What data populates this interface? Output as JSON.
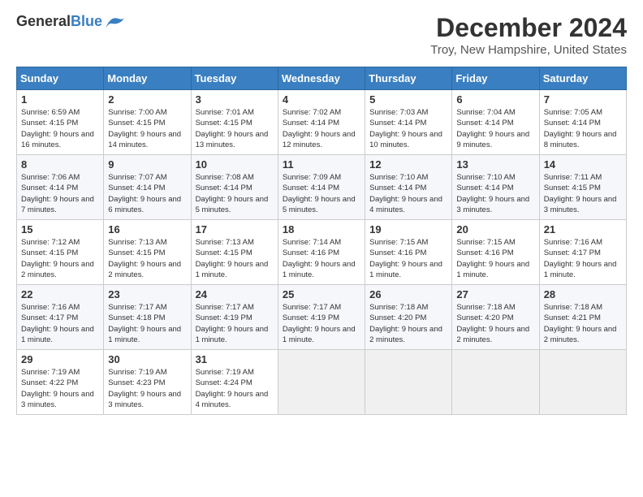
{
  "logo": {
    "general": "General",
    "blue": "Blue"
  },
  "header": {
    "month_title": "December 2024",
    "location": "Troy, New Hampshire, United States"
  },
  "days_of_week": [
    "Sunday",
    "Monday",
    "Tuesday",
    "Wednesday",
    "Thursday",
    "Friday",
    "Saturday"
  ],
  "weeks": [
    [
      {
        "day": "1",
        "info": "Sunrise: 6:59 AM\nSunset: 4:15 PM\nDaylight: 9 hours and 16 minutes."
      },
      {
        "day": "2",
        "info": "Sunrise: 7:00 AM\nSunset: 4:15 PM\nDaylight: 9 hours and 14 minutes."
      },
      {
        "day": "3",
        "info": "Sunrise: 7:01 AM\nSunset: 4:15 PM\nDaylight: 9 hours and 13 minutes."
      },
      {
        "day": "4",
        "info": "Sunrise: 7:02 AM\nSunset: 4:14 PM\nDaylight: 9 hours and 12 minutes."
      },
      {
        "day": "5",
        "info": "Sunrise: 7:03 AM\nSunset: 4:14 PM\nDaylight: 9 hours and 10 minutes."
      },
      {
        "day": "6",
        "info": "Sunrise: 7:04 AM\nSunset: 4:14 PM\nDaylight: 9 hours and 9 minutes."
      },
      {
        "day": "7",
        "info": "Sunrise: 7:05 AM\nSunset: 4:14 PM\nDaylight: 9 hours and 8 minutes."
      }
    ],
    [
      {
        "day": "8",
        "info": "Sunrise: 7:06 AM\nSunset: 4:14 PM\nDaylight: 9 hours and 7 minutes."
      },
      {
        "day": "9",
        "info": "Sunrise: 7:07 AM\nSunset: 4:14 PM\nDaylight: 9 hours and 6 minutes."
      },
      {
        "day": "10",
        "info": "Sunrise: 7:08 AM\nSunset: 4:14 PM\nDaylight: 9 hours and 5 minutes."
      },
      {
        "day": "11",
        "info": "Sunrise: 7:09 AM\nSunset: 4:14 PM\nDaylight: 9 hours and 5 minutes."
      },
      {
        "day": "12",
        "info": "Sunrise: 7:10 AM\nSunset: 4:14 PM\nDaylight: 9 hours and 4 minutes."
      },
      {
        "day": "13",
        "info": "Sunrise: 7:10 AM\nSunset: 4:14 PM\nDaylight: 9 hours and 3 minutes."
      },
      {
        "day": "14",
        "info": "Sunrise: 7:11 AM\nSunset: 4:15 PM\nDaylight: 9 hours and 3 minutes."
      }
    ],
    [
      {
        "day": "15",
        "info": "Sunrise: 7:12 AM\nSunset: 4:15 PM\nDaylight: 9 hours and 2 minutes."
      },
      {
        "day": "16",
        "info": "Sunrise: 7:13 AM\nSunset: 4:15 PM\nDaylight: 9 hours and 2 minutes."
      },
      {
        "day": "17",
        "info": "Sunrise: 7:13 AM\nSunset: 4:15 PM\nDaylight: 9 hours and 1 minute."
      },
      {
        "day": "18",
        "info": "Sunrise: 7:14 AM\nSunset: 4:16 PM\nDaylight: 9 hours and 1 minute."
      },
      {
        "day": "19",
        "info": "Sunrise: 7:15 AM\nSunset: 4:16 PM\nDaylight: 9 hours and 1 minute."
      },
      {
        "day": "20",
        "info": "Sunrise: 7:15 AM\nSunset: 4:16 PM\nDaylight: 9 hours and 1 minute."
      },
      {
        "day": "21",
        "info": "Sunrise: 7:16 AM\nSunset: 4:17 PM\nDaylight: 9 hours and 1 minute."
      }
    ],
    [
      {
        "day": "22",
        "info": "Sunrise: 7:16 AM\nSunset: 4:17 PM\nDaylight: 9 hours and 1 minute."
      },
      {
        "day": "23",
        "info": "Sunrise: 7:17 AM\nSunset: 4:18 PM\nDaylight: 9 hours and 1 minute."
      },
      {
        "day": "24",
        "info": "Sunrise: 7:17 AM\nSunset: 4:19 PM\nDaylight: 9 hours and 1 minute."
      },
      {
        "day": "25",
        "info": "Sunrise: 7:17 AM\nSunset: 4:19 PM\nDaylight: 9 hours and 1 minute."
      },
      {
        "day": "26",
        "info": "Sunrise: 7:18 AM\nSunset: 4:20 PM\nDaylight: 9 hours and 2 minutes."
      },
      {
        "day": "27",
        "info": "Sunrise: 7:18 AM\nSunset: 4:20 PM\nDaylight: 9 hours and 2 minutes."
      },
      {
        "day": "28",
        "info": "Sunrise: 7:18 AM\nSunset: 4:21 PM\nDaylight: 9 hours and 2 minutes."
      }
    ],
    [
      {
        "day": "29",
        "info": "Sunrise: 7:19 AM\nSunset: 4:22 PM\nDaylight: 9 hours and 3 minutes."
      },
      {
        "day": "30",
        "info": "Sunrise: 7:19 AM\nSunset: 4:23 PM\nDaylight: 9 hours and 3 minutes."
      },
      {
        "day": "31",
        "info": "Sunrise: 7:19 AM\nSunset: 4:24 PM\nDaylight: 9 hours and 4 minutes."
      },
      null,
      null,
      null,
      null
    ]
  ]
}
